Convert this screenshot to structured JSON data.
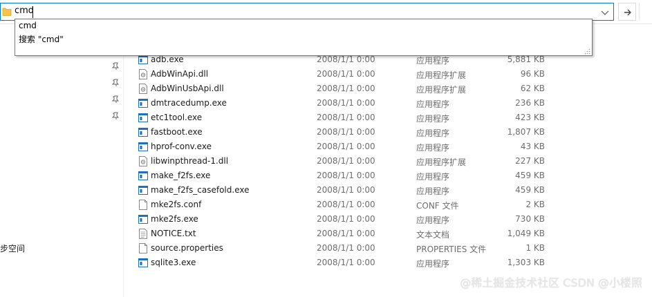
{
  "address_bar": {
    "value": "cmd"
  },
  "autocomplete": {
    "items": [
      "cmd",
      "搜索 \"cmd\""
    ]
  },
  "nav_pane": {
    "partial_label": "步空间"
  },
  "files": [
    {
      "name": "adb.exe",
      "date": "2008/1/1 0:00",
      "type": "应用程序",
      "size": "5,881 KB",
      "icon": "exe-icon"
    },
    {
      "name": "AdbWinApi.dll",
      "date": "2008/1/1 0:00",
      "type": "应用程序扩展",
      "size": "96 KB",
      "icon": "dll-icon"
    },
    {
      "name": "AdbWinUsbApi.dll",
      "date": "2008/1/1 0:00",
      "type": "应用程序扩展",
      "size": "62 KB",
      "icon": "dll-icon"
    },
    {
      "name": "dmtracedump.exe",
      "date": "2008/1/1 0:00",
      "type": "应用程序",
      "size": "236 KB",
      "icon": "exe-icon"
    },
    {
      "name": "etc1tool.exe",
      "date": "2008/1/1 0:00",
      "type": "应用程序",
      "size": "423 KB",
      "icon": "exe-icon"
    },
    {
      "name": "fastboot.exe",
      "date": "2008/1/1 0:00",
      "type": "应用程序",
      "size": "1,807 KB",
      "icon": "exe-icon"
    },
    {
      "name": "hprof-conv.exe",
      "date": "2008/1/1 0:00",
      "type": "应用程序",
      "size": "43 KB",
      "icon": "exe-icon"
    },
    {
      "name": "libwinpthread-1.dll",
      "date": "2008/1/1 0:00",
      "type": "应用程序扩展",
      "size": "227 KB",
      "icon": "dll-icon"
    },
    {
      "name": "make_f2fs.exe",
      "date": "2008/1/1 0:00",
      "type": "应用程序",
      "size": "459 KB",
      "icon": "exe-icon"
    },
    {
      "name": "make_f2fs_casefold.exe",
      "date": "2008/1/1 0:00",
      "type": "应用程序",
      "size": "459 KB",
      "icon": "exe-icon"
    },
    {
      "name": "mke2fs.conf",
      "date": "2008/1/1 0:00",
      "type": "CONF 文件",
      "size": "2 KB",
      "icon": "file-icon"
    },
    {
      "name": "mke2fs.exe",
      "date": "2008/1/1 0:00",
      "type": "应用程序",
      "size": "730 KB",
      "icon": "exe-icon"
    },
    {
      "name": "NOTICE.txt",
      "date": "2008/1/1 0:00",
      "type": "文本文档",
      "size": "1,049 KB",
      "icon": "text-file-icon"
    },
    {
      "name": "source.properties",
      "date": "2008/1/1 0:00",
      "type": "PROPERTIES 文件",
      "size": "1 KB",
      "icon": "file-icon"
    },
    {
      "name": "sqlite3.exe",
      "date": "2008/1/1 0:00",
      "type": "应用程序",
      "size": "1,303 KB",
      "icon": "exe-icon"
    }
  ],
  "watermark": "@稀土掘金技术社区 CSDN @小楼照",
  "colors": {
    "accent": "#0078d7",
    "exe_blue": "#1e6fbf",
    "muted_text": "#6d6d6d"
  }
}
